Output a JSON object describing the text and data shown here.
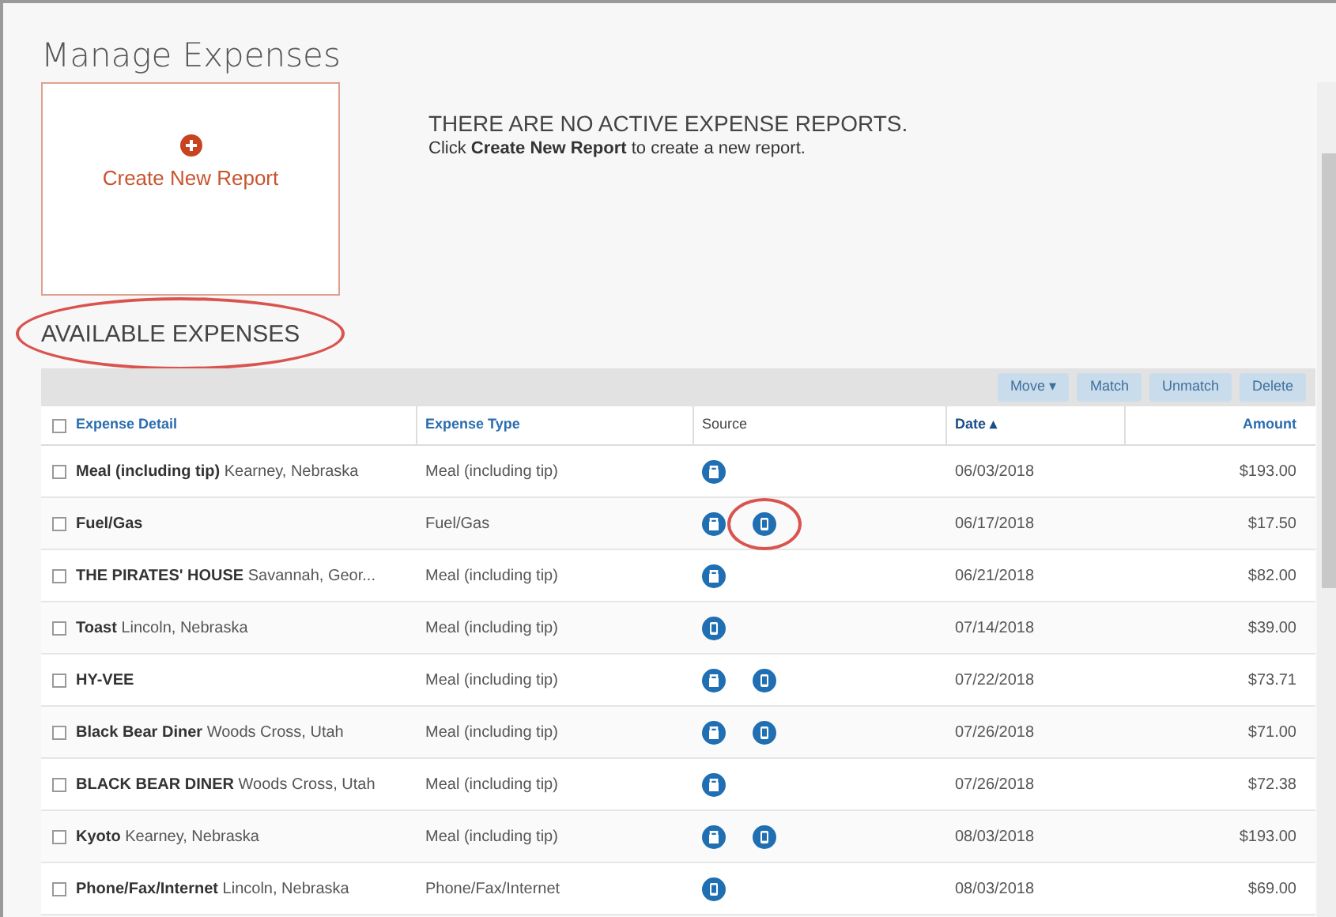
{
  "page_title": "Manage Expenses",
  "create_card": {
    "label": "Create New Report"
  },
  "empty_message": {
    "title": "THERE ARE NO ACTIVE EXPENSE REPORTS.",
    "text": "Click **Create New Report** to create a new report."
  },
  "section_heading": {
    "text": "AVAILABLE EXPENSES",
    "circled": true
  },
  "toolbar": [
    {
      "label": "Move ▾",
      "disabled": true
    },
    {
      "label": "Match",
      "disabled": true
    },
    {
      "label": "Unmatch",
      "disabled": true
    },
    {
      "label": "Delete",
      "disabled": true
    }
  ],
  "select_all": {
    "checked": false
  },
  "columns": [
    {
      "label": "Expense Detail",
      "sorted": false
    },
    {
      "label": "Expense Type",
      "sorted": false
    },
    {
      "label": "Source",
      "sorted": false
    },
    {
      "label": "Date ▴",
      "sorted": true
    },
    {
      "label": "Amount",
      "sorted": false
    }
  ],
  "rows": [
    {
      "checked": false,
      "merchant": "Meal (including tip)",
      "location": "Kearney, Nebraska",
      "type": "Meal (including tip)",
      "sources": [
        {
          "kind": "receipt",
          "circled": false
        }
      ],
      "date": "06/03/2018",
      "amount": "$193.00"
    },
    {
      "checked": false,
      "merchant": "Fuel/Gas",
      "type": "Fuel/Gas",
      "sources": [
        {
          "kind": "receipt",
          "circled": false
        },
        {
          "kind": "mobile",
          "circled": true
        }
      ],
      "date": "06/17/2018",
      "amount": "$17.50"
    },
    {
      "checked": false,
      "merchant": "THE PIRATES' HOUSE",
      "location": "Savannah, Geor...",
      "type": "Meal (including tip)",
      "sources": [
        {
          "kind": "receipt",
          "circled": false
        }
      ],
      "date": "06/21/2018",
      "amount": "$82.00"
    },
    {
      "checked": false,
      "merchant": "Toast",
      "location": "Lincoln, Nebraska",
      "type": "Meal (including tip)",
      "sources": [
        {
          "kind": "mobile",
          "circled": false
        }
      ],
      "date": "07/14/2018",
      "amount": "$39.00"
    },
    {
      "checked": false,
      "merchant": "HY-VEE",
      "type": "Meal (including tip)",
      "sources": [
        {
          "kind": "receipt",
          "circled": false
        },
        {
          "kind": "mobile",
          "circled": false
        }
      ],
      "date": "07/22/2018",
      "amount": "$73.71"
    },
    {
      "checked": false,
      "merchant": "Black Bear Diner",
      "location": "Woods Cross, Utah",
      "type": "Meal (including tip)",
      "sources": [
        {
          "kind": "receipt",
          "circled": false
        },
        {
          "kind": "mobile",
          "circled": false
        }
      ],
      "date": "07/26/2018",
      "amount": "$71.00"
    },
    {
      "checked": false,
      "merchant": "BLACK BEAR DINER",
      "location": "Woods Cross, Utah",
      "type": "Meal (including tip)",
      "sources": [
        {
          "kind": "receipt",
          "circled": false
        }
      ],
      "date": "07/26/2018",
      "amount": "$72.38"
    },
    {
      "checked": false,
      "merchant": "Kyoto",
      "location": "Kearney, Nebraska",
      "type": "Meal (including tip)",
      "sources": [
        {
          "kind": "receipt",
          "circled": false
        },
        {
          "kind": "mobile",
          "circled": false
        }
      ],
      "date": "08/03/2018",
      "amount": "$193.00"
    },
    {
      "checked": false,
      "merchant": "Phone/Fax/Internet",
      "location": "Lincoln, Nebraska",
      "type": "Phone/Fax/Internet",
      "sources": [
        {
          "kind": "mobile",
          "circled": false
        }
      ],
      "date": "08/03/2018",
      "amount": "$69.00"
    }
  ]
}
